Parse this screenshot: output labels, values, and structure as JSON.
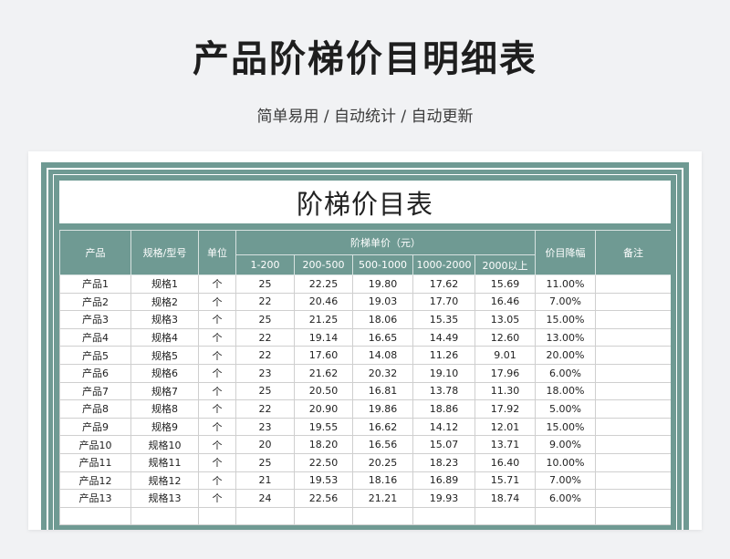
{
  "header": {
    "title": "产品阶梯价目明细表",
    "subtitle": "简单易用 / 自动统计 / 自动更新"
  },
  "sheet": {
    "banner": "阶梯价目表",
    "columns": {
      "product": "产品",
      "spec": "规格/型号",
      "unit": "单位",
      "tier_group": "阶梯单价（元）",
      "tiers": [
        "1-200",
        "200-500",
        "500-1000",
        "1000-2000",
        "2000以上"
      ],
      "drop": "价目降幅",
      "note": "备注"
    },
    "rows": [
      {
        "product": "产品1",
        "spec": "规格1",
        "unit": "个",
        "p1": "25",
        "p2": "22.25",
        "p3": "19.80",
        "p4": "17.62",
        "p5": "15.69",
        "drop": "11.00%",
        "note": ""
      },
      {
        "product": "产品2",
        "spec": "规格2",
        "unit": "个",
        "p1": "22",
        "p2": "20.46",
        "p3": "19.03",
        "p4": "17.70",
        "p5": "16.46",
        "drop": "7.00%",
        "note": ""
      },
      {
        "product": "产品3",
        "spec": "规格3",
        "unit": "个",
        "p1": "25",
        "p2": "21.25",
        "p3": "18.06",
        "p4": "15.35",
        "p5": "13.05",
        "drop": "15.00%",
        "note": ""
      },
      {
        "product": "产品4",
        "spec": "规格4",
        "unit": "个",
        "p1": "22",
        "p2": "19.14",
        "p3": "16.65",
        "p4": "14.49",
        "p5": "12.60",
        "drop": "13.00%",
        "note": ""
      },
      {
        "product": "产品5",
        "spec": "规格5",
        "unit": "个",
        "p1": "22",
        "p2": "17.60",
        "p3": "14.08",
        "p4": "11.26",
        "p5": "9.01",
        "drop": "20.00%",
        "note": ""
      },
      {
        "product": "产品6",
        "spec": "规格6",
        "unit": "个",
        "p1": "23",
        "p2": "21.62",
        "p3": "20.32",
        "p4": "19.10",
        "p5": "17.96",
        "drop": "6.00%",
        "note": ""
      },
      {
        "product": "产品7",
        "spec": "规格7",
        "unit": "个",
        "p1": "25",
        "p2": "20.50",
        "p3": "16.81",
        "p4": "13.78",
        "p5": "11.30",
        "drop": "18.00%",
        "note": ""
      },
      {
        "product": "产品8",
        "spec": "规格8",
        "unit": "个",
        "p1": "22",
        "p2": "20.90",
        "p3": "19.86",
        "p4": "18.86",
        "p5": "17.92",
        "drop": "5.00%",
        "note": ""
      },
      {
        "product": "产品9",
        "spec": "规格9",
        "unit": "个",
        "p1": "23",
        "p2": "19.55",
        "p3": "16.62",
        "p4": "14.12",
        "p5": "12.01",
        "drop": "15.00%",
        "note": ""
      },
      {
        "product": "产品10",
        "spec": "规格10",
        "unit": "个",
        "p1": "20",
        "p2": "18.20",
        "p3": "16.56",
        "p4": "15.07",
        "p5": "13.71",
        "drop": "9.00%",
        "note": ""
      },
      {
        "product": "产品11",
        "spec": "规格11",
        "unit": "个",
        "p1": "25",
        "p2": "22.50",
        "p3": "20.25",
        "p4": "18.23",
        "p5": "16.40",
        "drop": "10.00%",
        "note": ""
      },
      {
        "product": "产品12",
        "spec": "规格12",
        "unit": "个",
        "p1": "21",
        "p2": "19.53",
        "p3": "18.16",
        "p4": "16.89",
        "p5": "15.71",
        "drop": "7.00%",
        "note": ""
      },
      {
        "product": "产品13",
        "spec": "规格13",
        "unit": "个",
        "p1": "24",
        "p2": "22.56",
        "p3": "21.21",
        "p4": "19.93",
        "p5": "18.74",
        "drop": "6.00%",
        "note": ""
      },
      {
        "product": "",
        "spec": "",
        "unit": "",
        "p1": "",
        "p2": "",
        "p3": "",
        "p4": "",
        "p5": "",
        "drop": "",
        "note": ""
      }
    ]
  },
  "colors": {
    "frame": "#6f9a93",
    "page_background": "#f1f2f4"
  }
}
